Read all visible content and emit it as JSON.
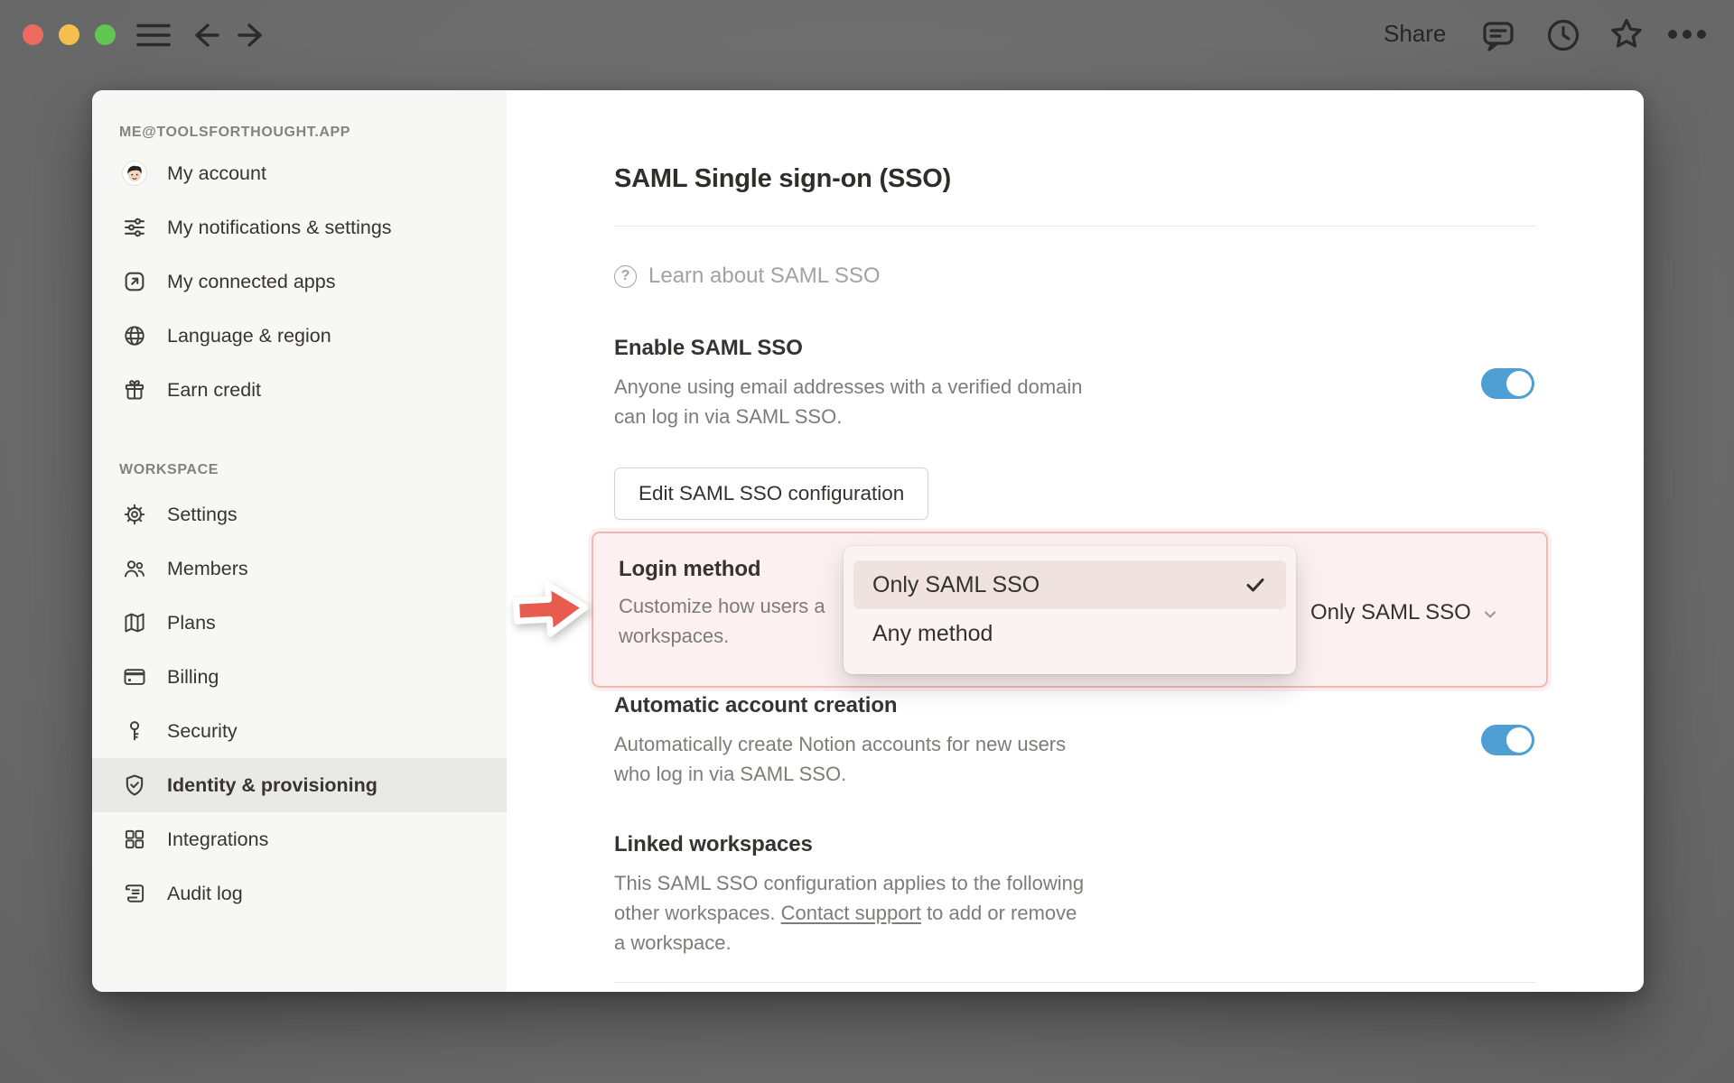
{
  "window": {
    "share_label": "Share"
  },
  "sidebar": {
    "account_header": "ME@TOOLSFORTHOUGHT.APP",
    "account_items": [
      {
        "label": "My account",
        "icon": "avatar"
      },
      {
        "label": "My notifications & settings",
        "icon": "sliders-icon"
      },
      {
        "label": "My connected apps",
        "icon": "external-link-icon"
      },
      {
        "label": "Language & region",
        "icon": "globe-icon"
      },
      {
        "label": "Earn credit",
        "icon": "gift-icon"
      }
    ],
    "workspace_header": "WORKSPACE",
    "workspace_items": [
      {
        "label": "Settings",
        "icon": "gear-icon",
        "active": false
      },
      {
        "label": "Members",
        "icon": "members-icon",
        "active": false
      },
      {
        "label": "Plans",
        "icon": "map-icon",
        "active": false
      },
      {
        "label": "Billing",
        "icon": "credit-card-icon",
        "active": false
      },
      {
        "label": "Security",
        "icon": "key-icon",
        "active": false
      },
      {
        "label": "Identity & provisioning",
        "icon": "shield-check-icon",
        "active": true
      },
      {
        "label": "Integrations",
        "icon": "grid-icon",
        "active": false
      },
      {
        "label": "Audit log",
        "icon": "scroll-icon",
        "active": false
      }
    ]
  },
  "main": {
    "title": "SAML Single sign-on (SSO)",
    "learn_link": "Learn about SAML SSO",
    "enable_sso": {
      "title": "Enable SAML SSO",
      "desc_line1": "Anyone using email addresses with a verified domain",
      "desc_line2": "can log in via SAML SSO.",
      "enabled": true
    },
    "edit_button": "Edit SAML SSO configuration",
    "login_method": {
      "title": "Login method",
      "desc_visible_line1": "Customize how users a",
      "desc_visible_line2": "workspaces.",
      "selected_value": "Only SAML SSO"
    },
    "dropdown": {
      "options": [
        {
          "label": "Only SAML SSO",
          "selected": true
        },
        {
          "label": "Any method",
          "selected": false
        }
      ]
    },
    "auto_account": {
      "title": "Automatic account creation",
      "desc_line1": "Automatically create Notion accounts for new users",
      "desc_line2": "who log in via SAML SSO.",
      "enabled": true
    },
    "linked_workspaces": {
      "title": "Linked workspaces",
      "desc_line1": "This SAML SSO configuration applies to the following",
      "desc_line2_pre": "other workspaces. ",
      "desc_line2_link": "Contact support",
      "desc_line2_post": " to add or remove",
      "desc_line3": "a workspace."
    }
  },
  "colors": {
    "toggle_blue": "#4d9fd4",
    "highlight_pink_bg": "#fcf1f0",
    "highlight_pink_border": "#eeb9b4",
    "arrow_red": "#e85c50",
    "sidebar_bg": "#f7f7f5",
    "sidebar_active_bg": "#e9e9e7"
  }
}
